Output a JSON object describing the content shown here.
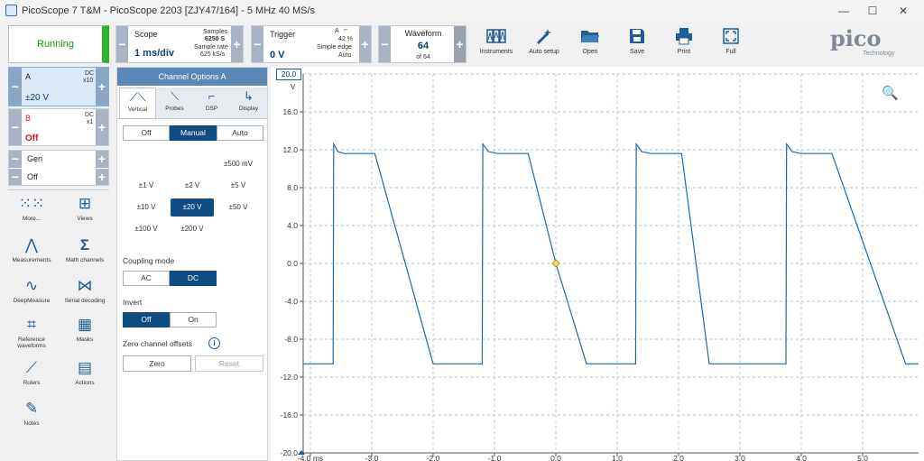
{
  "window": {
    "title": "PicoScope 7 T&M  - PicoScope 2203 [ZJY47/164] - 5 MHz 40 MS/s",
    "min": "—",
    "max": "☐",
    "close": "✕"
  },
  "run": {
    "label": "Running"
  },
  "scope_group": {
    "title": "Scope",
    "timebase": "1 ms/div",
    "samples_label": "Samples",
    "samples": "6250 S",
    "rate_label": "Sample rate",
    "rate": "625 kS/s",
    "minus": "−",
    "plus": "+"
  },
  "trigger_group": {
    "title": "Trigger",
    "level": "0 V",
    "channel": "A",
    "edge": "⌐",
    "percent": "42 %",
    "type": "Simple edge",
    "mode": "Auto",
    "minus": "−",
    "plus": "+"
  },
  "waveform_group": {
    "title": "Waveform",
    "current": "64",
    "of": "of 64",
    "minus": "−",
    "plus": "+"
  },
  "toolbar": {
    "items": [
      {
        "label": "Instruments",
        "icon": "instruments-icon"
      },
      {
        "label": "Auto setup",
        "icon": "wand-icon"
      },
      {
        "label": "Open",
        "icon": "folder-icon"
      },
      {
        "label": "Save",
        "icon": "floppy-icon"
      },
      {
        "label": "Print",
        "icon": "printer-icon"
      },
      {
        "label": "Full",
        "icon": "fullscreen-icon"
      }
    ]
  },
  "logo": {
    "main": "pico",
    "sub": "Technology"
  },
  "channels": [
    {
      "name": "A",
      "coupling": "DC",
      "probe": "x10",
      "range": "±20 V",
      "minus": "−",
      "plus": "+"
    },
    {
      "name": "B",
      "coupling": "DC",
      "probe": "x1",
      "range": "Off",
      "minus": "−",
      "plus": "+"
    },
    {
      "name": "Gen",
      "range": "Off",
      "minus": "−",
      "plus": "+"
    }
  ],
  "nav": [
    {
      "label": "More...",
      "icon": "grid-dots-icon"
    },
    {
      "label": "Views",
      "icon": "views-icon"
    },
    {
      "label": "Measurements",
      "icon": "calipers-icon"
    },
    {
      "label": "Math channels",
      "icon": "sigma-icon"
    },
    {
      "label": "DeepMeasure",
      "icon": "deepmeasure-icon"
    },
    {
      "label": "Serial decoding",
      "icon": "serial-icon"
    },
    {
      "label": "Reference waveforms",
      "icon": "reference-icon"
    },
    {
      "label": "Masks",
      "icon": "masks-icon"
    },
    {
      "label": "Rulers",
      "icon": "ruler-icon"
    },
    {
      "label": "Actions",
      "icon": "clapper-icon"
    },
    {
      "label": "Notes",
      "icon": "notes-icon"
    }
  ],
  "channel_options": {
    "title": "Channel Options A",
    "tabs": [
      "Vertical",
      "Probes",
      "DSP",
      "Display"
    ],
    "range_mode": [
      "Off",
      "Manual",
      "Auto"
    ],
    "ranges": [
      "±500 mV",
      "±1 V",
      "±2 V",
      "±5 V",
      "±10 V",
      "±20 V",
      "±50 V",
      "±100 V",
      "±200 V"
    ],
    "coupling_label": "Coupling mode",
    "coupling": [
      "AC",
      "DC"
    ],
    "invert_label": "Invert",
    "invert": [
      "Off",
      "On"
    ],
    "zero_label": "Zero channel offsets",
    "info": "i",
    "zero": "Zero",
    "reset": "Reset"
  },
  "chart_data": {
    "type": "line",
    "y_unit": "V",
    "y_top_label": "20.0",
    "y_ticks": [
      "16.0",
      "12.0",
      "8.0",
      "4.0",
      "0.0",
      "-4.0",
      "-8.0",
      "-12.0",
      "-16.0",
      "-20.0"
    ],
    "x_ticks": [
      "-4.0 ms",
      "-3.0",
      "-2.0",
      "-1.0",
      "0.0",
      "1.0",
      "2.0",
      "3.0",
      "4.0",
      "5.0"
    ],
    "xlim": [
      -4.0,
      5.0
    ],
    "ylim": [
      -20,
      20
    ],
    "grid": true,
    "series": [
      {
        "values_x": [
          -4.3,
          -3.63,
          -3.62,
          -3.55,
          -3.45,
          -2.95,
          -2.0,
          -1.2,
          -1.19,
          -1.1,
          -0.95,
          -0.45,
          0.0,
          0.5,
          1.3,
          1.31,
          1.4,
          1.55,
          2.05,
          2.5,
          3.0,
          3.75,
          3.76,
          3.85,
          4.0,
          4.5,
          5.7,
          6.0
        ],
        "values_y": [
          -10.6,
          -10.6,
          12.6,
          11.8,
          11.6,
          11.6,
          -10.6,
          -10.6,
          12.6,
          11.8,
          11.6,
          11.6,
          0.0,
          -10.6,
          -10.6,
          12.6,
          11.8,
          11.6,
          11.6,
          -10.6,
          -10.6,
          -10.6,
          12.6,
          11.8,
          11.6,
          11.6,
          -10.6,
          -10.6
        ]
      }
    ],
    "trigger_point": {
      "x": 0.0,
      "y": 0.0
    },
    "color": "#1c6aa8"
  }
}
